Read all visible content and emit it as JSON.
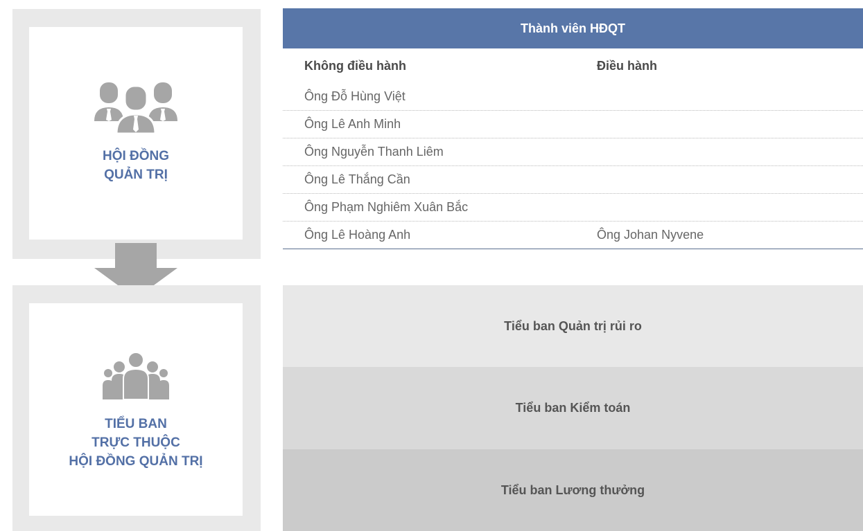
{
  "board_panel": {
    "icon": "group-of-three-people-icon",
    "title_line1": "HỘI ĐỒNG",
    "title_line2": "QUẢN TRỊ"
  },
  "committee_panel": {
    "icon": "group-of-five-people-icon",
    "title_line1": "TIỂU BAN",
    "title_line2": "TRỰC THUỘC",
    "title_line3": "HỘI ĐỒNG QUẢN TRỊ"
  },
  "board_table": {
    "title": "Thành viên HĐQT",
    "columns": [
      "Không điều hành",
      "Điều hành"
    ],
    "rows": [
      [
        "Ông Đỗ Hùng Việt",
        ""
      ],
      [
        "Ông Lê Anh Minh",
        ""
      ],
      [
        "Ông Nguyễn Thanh Liêm",
        ""
      ],
      [
        "Ông Lê Thắng Cần",
        ""
      ],
      [
        "Ông Phạm Nghiêm Xuân Bắc",
        ""
      ],
      [
        "Ông Lê Hoàng Anh",
        "Ông Johan Nyvene"
      ]
    ]
  },
  "committees": [
    {
      "label": "Tiểu ban Quản trị rủi ro",
      "color": "#e8e8e8"
    },
    {
      "label": "Tiểu ban Kiểm toán",
      "color": "#d9d9d9"
    },
    {
      "label": "Tiểu ban Lương thưởng",
      "color": "#cbcbcb"
    }
  ],
  "colors": {
    "accent": "#5876a8",
    "panel_bg": "#e9e9e9",
    "icon_gray": "#a6a6a6"
  }
}
